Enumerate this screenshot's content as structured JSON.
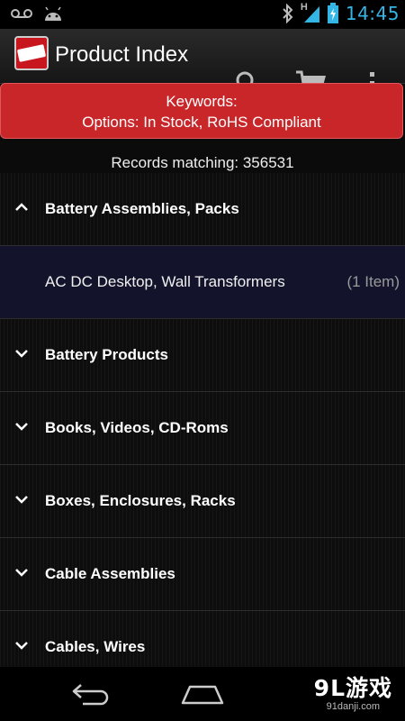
{
  "status_bar": {
    "time": "14:45",
    "icons": [
      "voicemail-icon",
      "android-icon",
      "bluetooth-icon",
      "signal-icon",
      "battery-icon"
    ],
    "network_label": "H",
    "accent_color": "#33b5e5"
  },
  "action_bar": {
    "title": "Product Index",
    "logo_icon": "digikey-logo-icon",
    "actions": [
      "search-icon",
      "cart-icon",
      "overflow-menu-icon"
    ]
  },
  "banner": {
    "line1": "Keywords:",
    "line2": "Options: In Stock, RoHS Compliant",
    "color": "#c9262a"
  },
  "records": {
    "text": "Records matching: 356531"
  },
  "categories": [
    {
      "label": "Battery Assemblies, Packs",
      "expanded": true
    },
    {
      "label": "Battery Products",
      "expanded": false
    },
    {
      "label": "Books, Videos, CD-Roms",
      "expanded": false
    },
    {
      "label": "Boxes, Enclosures, Racks",
      "expanded": false
    },
    {
      "label": "Cable Assemblies",
      "expanded": false
    },
    {
      "label": "Cables, Wires",
      "expanded": false
    }
  ],
  "subcategory": {
    "label": "AC DC Desktop, Wall Transformers",
    "count": "(1 Item)"
  },
  "nav_bar": {
    "buttons": [
      "back-icon",
      "home-icon"
    ]
  },
  "watermark": {
    "text": "9L游戏",
    "url": "91danji.com"
  }
}
